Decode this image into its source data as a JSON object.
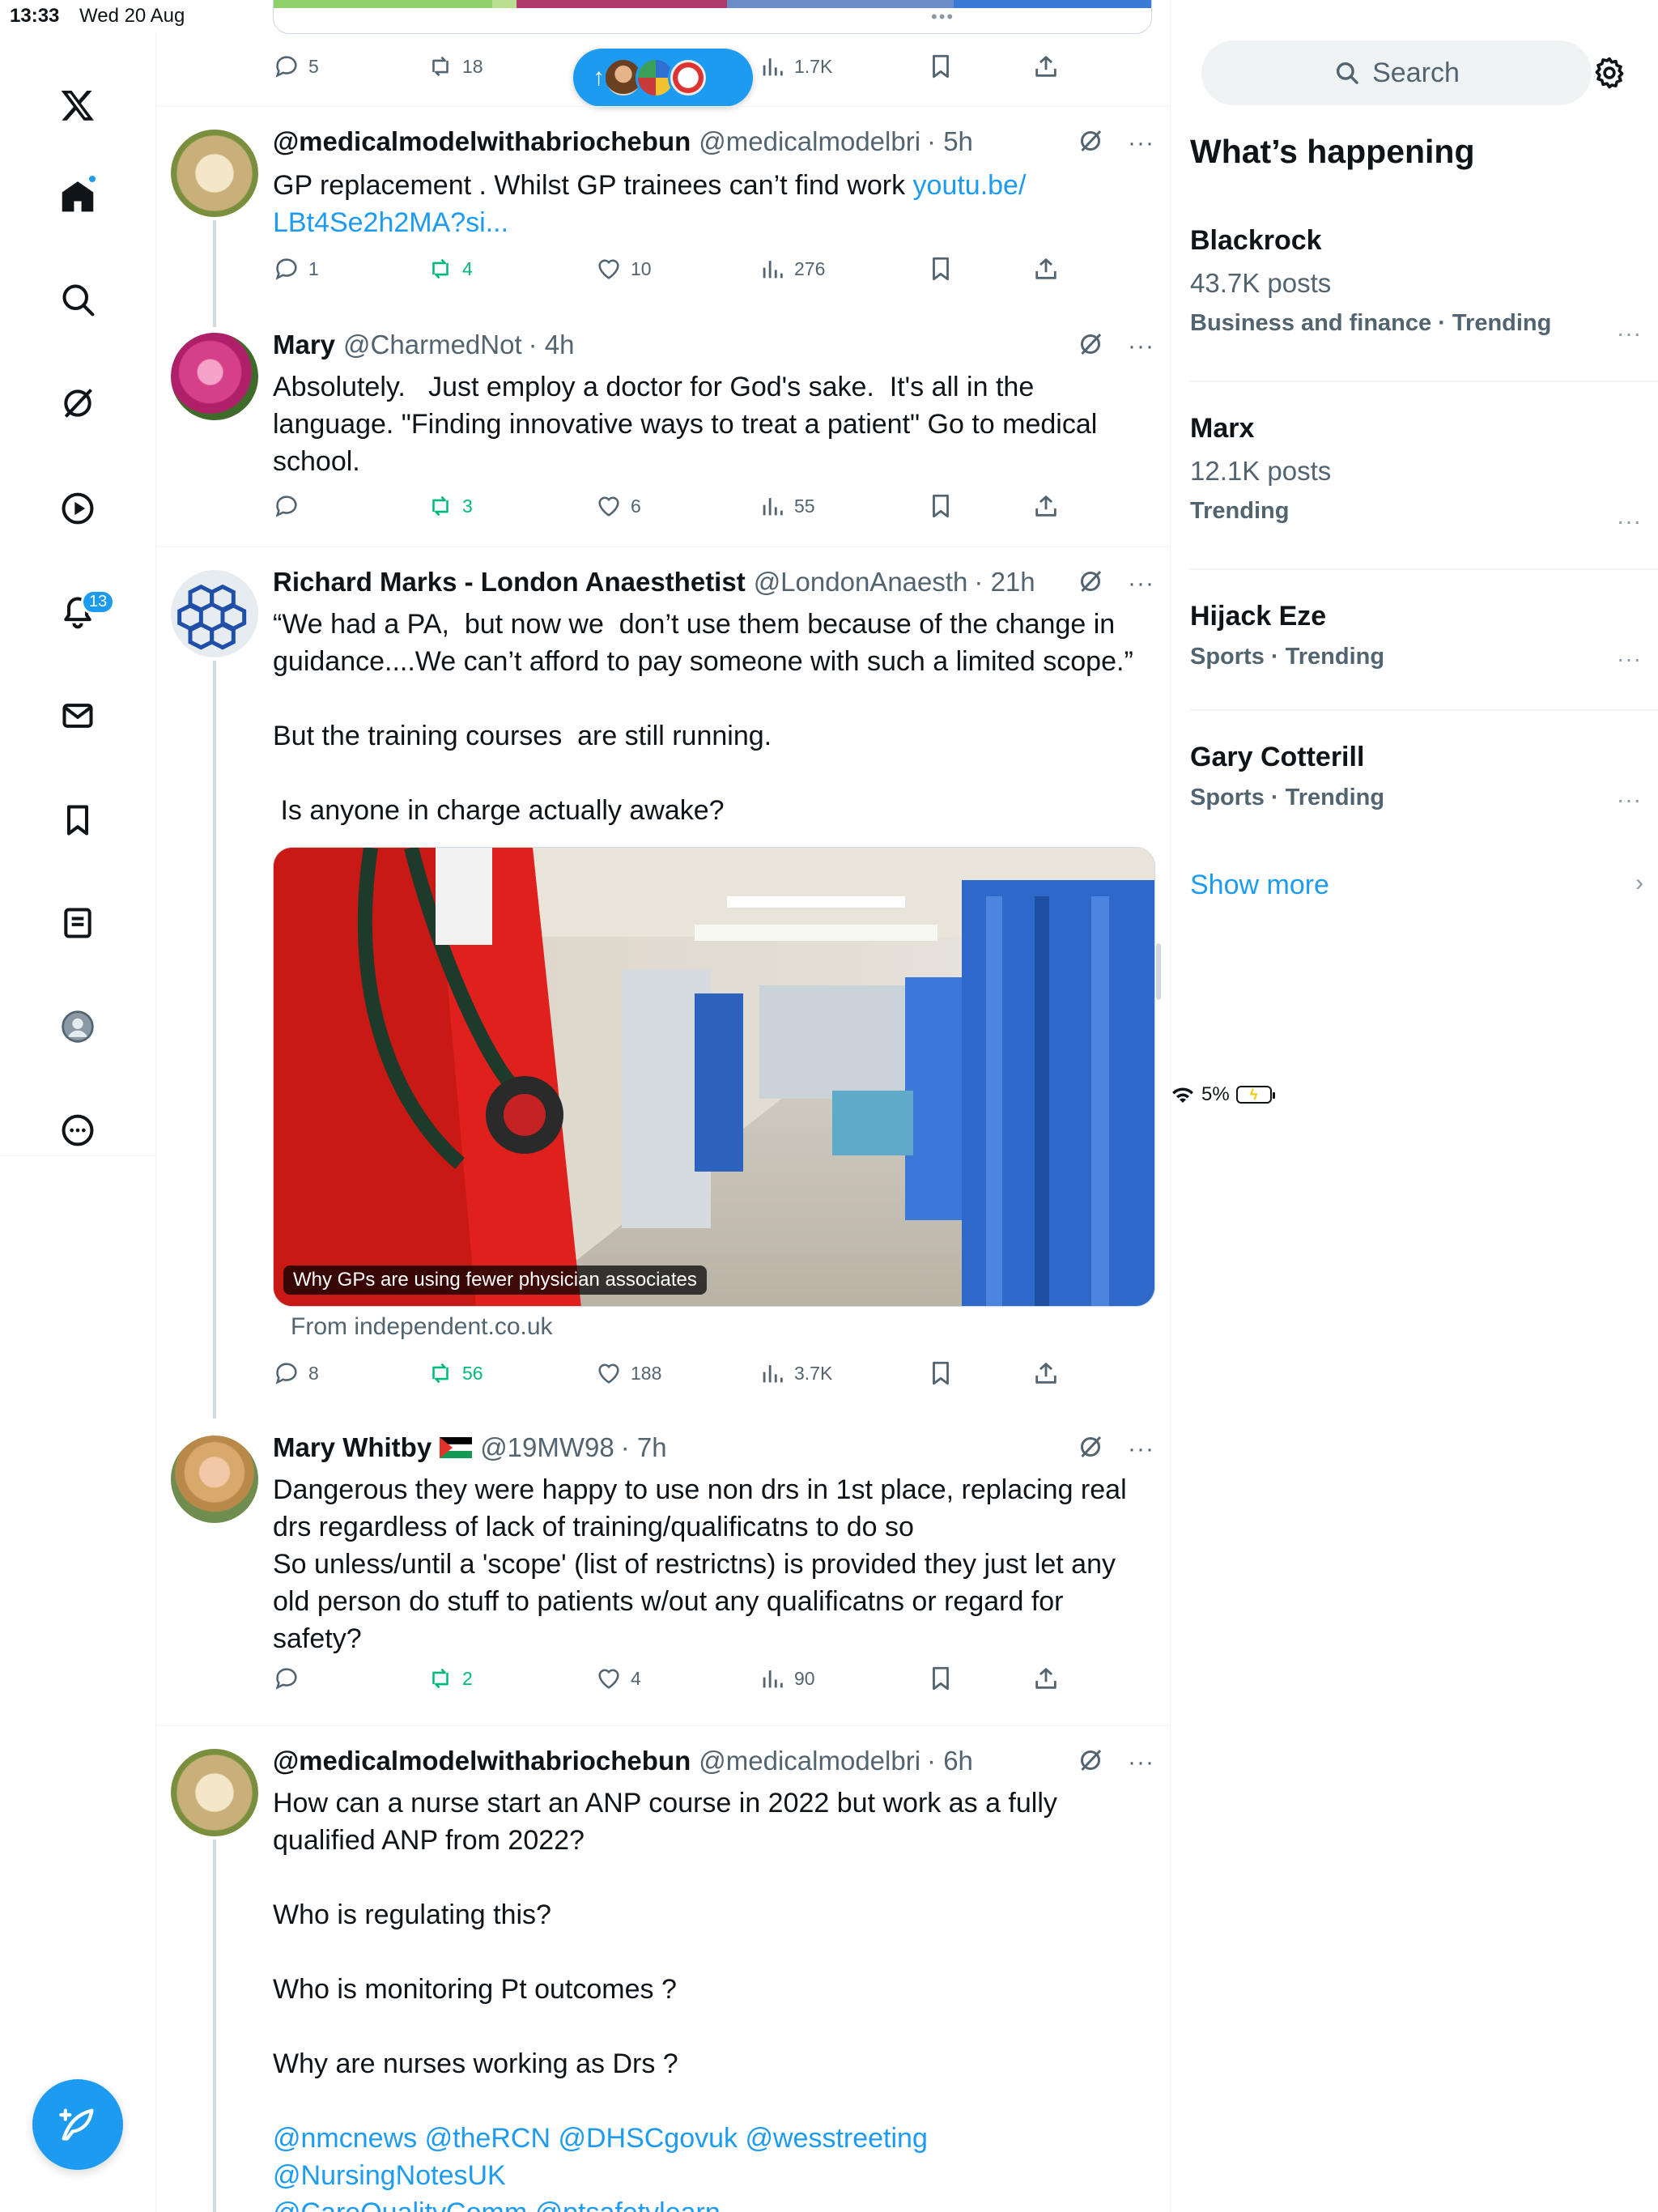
{
  "status_bar": {
    "time": "13:33",
    "date": "Wed 20 Aug",
    "battery": "5%"
  },
  "nav": {
    "notifications_badge": "13",
    "items": [
      "home",
      "explore",
      "grok",
      "video",
      "notifications",
      "messages",
      "bookmarks",
      "lists",
      "profile",
      "more"
    ]
  },
  "new_posts_pill": {
    "arrow": "↑"
  },
  "top_actions": {
    "replies": "5",
    "reposts": "18",
    "views": "1.7K"
  },
  "tweets": [
    {
      "name": "@medicalmodelwithabriochebun",
      "handle": "@medicalmodelbri",
      "time": "· 5h",
      "text": "GP replacement . Whilst GP trainees can’t find work ",
      "link": "youtu.be/\nLBt4Se2h2MA?si...",
      "replies": "1",
      "reposts": "4",
      "likes": "10",
      "views": "276"
    },
    {
      "name": "Mary",
      "handle": "@CharmedNot",
      "time": "· 4h",
      "text": "Absolutely.   Just employ a doctor for God's sake.  It's all in the\nlanguage. \"Finding innovative ways to treat a patient\" Go to medical\nschool.",
      "replies": "",
      "reposts": "3",
      "likes": "6",
      "views": "55"
    },
    {
      "name": "Richard Marks - London Anaesthetist",
      "handle": "@LondonAnaesth",
      "time": "· 21h",
      "text": "“We had a PA,  but now we  don’t use them because of the change in\nguidance....We can’t afford to pay someone with such a limited scope.”\n\nBut the training courses  are still running.\n\n Is anyone in charge actually awake?",
      "card_caption": "Why GPs are using fewer physician associates",
      "card_from": "From independent.co.uk",
      "replies": "8",
      "reposts": "56",
      "likes": "188",
      "views": "3.7K"
    },
    {
      "name": "Mary Whitby",
      "handle": "@19MW98",
      "time": "· 7h",
      "text": "Dangerous they were happy to use non drs in 1st place, replacing real\ndrs regardless of lack of training/qualificatns to do so\nSo unless/until a 'scope' (list of restrictns) is provided they just let any\nold person do stuff to patients w/out any qualificatns or regard for\nsafety?",
      "replies": "",
      "reposts": "2",
      "likes": "4",
      "views": "90"
    },
    {
      "name": "@medicalmodelwithabriochebun",
      "handle": "@medicalmodelbri",
      "time": "· 6h",
      "text": "How can a nurse start an ANP course in 2022 but work as a fully\nqualified ANP from 2022?\n\nWho is regulating this?\n\nWho is monitoring Pt outcomes ?\n\nWhy are nurses working as Drs ?\n",
      "mentions": "@nmcnews @theRCN @DHSCgovuk @wesstreeting @NursingNotesUK\n@CareQualityComm @ptsafetylearn"
    }
  ],
  "sidebar": {
    "search_placeholder": "Search",
    "heading": "What’s happening",
    "trends": [
      {
        "name": "Blackrock",
        "posts": "43.7K posts",
        "category": "Business and finance · Trending"
      },
      {
        "name": "Marx",
        "posts": "12.1K posts",
        "category": "Trending"
      },
      {
        "name": "Hijack Eze",
        "posts": "",
        "category": "Sports · Trending"
      },
      {
        "name": "Gary Cotterill",
        "posts": "",
        "category": "Sports · Trending"
      }
    ],
    "show_more": "Show more"
  },
  "colors": {
    "accent": "#1d9bf0",
    "repost": "#00ba7c",
    "muted": "#536471"
  }
}
